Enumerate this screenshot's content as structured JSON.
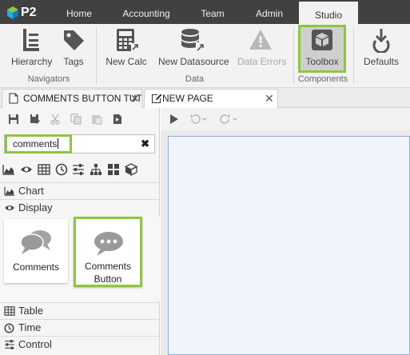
{
  "app": {
    "logo_text": "P2",
    "menu_tabs": [
      "Home",
      "Accounting",
      "Team",
      "Admin",
      "Studio"
    ],
    "active_menu_tab": "Studio"
  },
  "ribbon": {
    "groups": [
      {
        "label": "Navigators",
        "buttons": [
          "Hierarchy",
          "Tags"
        ]
      },
      {
        "label": "Data",
        "buttons": [
          "New Calc",
          "New Datasource",
          "Data Errors"
        ]
      },
      {
        "label": "Components",
        "buttons": [
          "Toolbox"
        ]
      },
      {
        "label": "",
        "buttons": [
          "Defaults"
        ]
      }
    ],
    "disabled_buttons": [
      "Data Errors"
    ],
    "selected_button": "Toolbox"
  },
  "doc_tabs": [
    {
      "label": "COMMENTS BUTTON TUT",
      "icon": "page-icon"
    },
    {
      "label": "NEW PAGE",
      "icon": "edit-page-icon",
      "active": true
    }
  ],
  "left_panel": {
    "search": {
      "value": "comments",
      "placeholder": ""
    },
    "filter_icons": [
      "area-chart-icon",
      "eye-icon",
      "table-icon",
      "clock-icon",
      "sliders-icon",
      "hierarchy-icon",
      "grid-icon",
      "cube-icon"
    ],
    "categories_top": [
      {
        "label": "Chart",
        "icon": "area-chart-icon"
      },
      {
        "label": "Display",
        "icon": "eye-icon"
      }
    ],
    "components": [
      {
        "label": "Comments",
        "icon": "comments-icon"
      },
      {
        "label": "Comments Button",
        "label_line1": "Comments",
        "label_line2": "Button",
        "icon": "comment-dots-icon"
      }
    ],
    "categories_bottom": [
      {
        "label": "Table",
        "icon": "table-icon"
      },
      {
        "label": "Time",
        "icon": "clock-icon"
      },
      {
        "label": "Control",
        "icon": "sliders-icon"
      }
    ]
  },
  "colors": {
    "menubar": "#414141",
    "highlight": "#8dc63f",
    "canvas_bg": "#f1f4fb",
    "canvas_border": "#8fb0e2"
  }
}
